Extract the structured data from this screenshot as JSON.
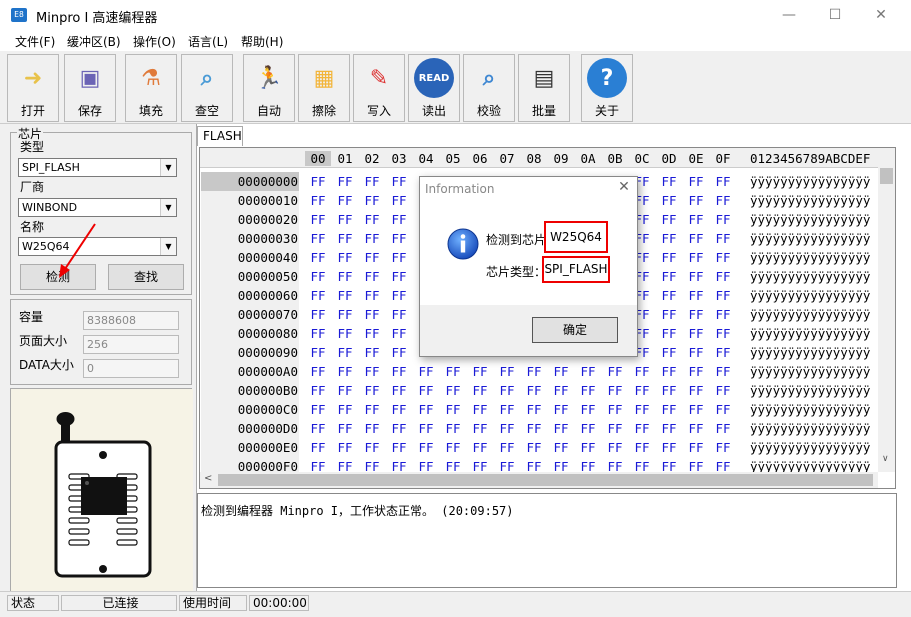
{
  "window": {
    "title": "Minpro I 高速编程器",
    "app_icon": "E8",
    "minimize": "—",
    "maximize": "☐",
    "close": "✕"
  },
  "menu": [
    "文件(F)",
    "缓冲区(B)",
    "操作(O)",
    "语言(L)",
    "帮助(H)"
  ],
  "toolbar": [
    {
      "label": "打开",
      "icon": "folder-open-icon",
      "glyph": "➜",
      "color": "#e8c24a"
    },
    {
      "label": "保存",
      "icon": "floppy-disk-icon",
      "glyph": "▣",
      "color": "#6b63b5"
    },
    {
      "label": "填充",
      "icon": "flask-icon",
      "glyph": "⚗",
      "color": "#e07a3a"
    },
    {
      "label": "查空",
      "icon": "magnifier-icon",
      "glyph": "⌕",
      "color": "#4a9bd6"
    },
    {
      "label": "自动",
      "icon": "running-man-icon",
      "glyph": "🏃",
      "color": "#f39a1c"
    },
    {
      "label": "擦除",
      "icon": "box-icon",
      "glyph": "▦",
      "color": "#f2b53a"
    },
    {
      "label": "写入",
      "icon": "pencil-paper-icon",
      "glyph": "✎",
      "color": "#d33"
    },
    {
      "label": "读出",
      "icon": "read-disc-icon",
      "glyph": "READ",
      "color": "#2a64b8"
    },
    {
      "label": "校验",
      "icon": "verify-magnifier-icon",
      "glyph": "⌕",
      "color": "#3e87d2"
    },
    {
      "label": "批量",
      "icon": "chip-icon",
      "glyph": "▤",
      "color": "#333"
    },
    {
      "label": "关于",
      "icon": "help-icon",
      "glyph": "?",
      "color": "#2a7fd4"
    }
  ],
  "chip_group": {
    "title": "芯片",
    "type_label": "类型",
    "type_value": "SPI_FLASH",
    "vendor_label": "厂商",
    "vendor_value": "WINBOND",
    "name_label": "名称",
    "name_value": "W25Q64",
    "detect_button": "检测",
    "search_button": "查找"
  },
  "info_fields": {
    "capacity_label": "容量",
    "capacity_value": "8388608",
    "page_size_label": "页面大小",
    "page_size_value": "256",
    "data_size_label": "DATA大小",
    "data_size_value": "0"
  },
  "buffer": {
    "tab": "FLASH",
    "columns": [
      "00",
      "01",
      "02",
      "03",
      "04",
      "05",
      "06",
      "07",
      "08",
      "09",
      "0A",
      "0B",
      "0C",
      "0D",
      "0E",
      "0F"
    ],
    "ascii_header": "0123456789ABCDEF",
    "rows": [
      {
        "addr": "00000000",
        "bytes": "FF",
        "ascii": "ÿÿÿÿÿÿÿÿÿÿÿÿÿÿÿÿ"
      },
      {
        "addr": "00000010",
        "bytes": "FF",
        "ascii": "ÿÿÿÿÿÿÿÿÿÿÿÿÿÿÿÿ"
      },
      {
        "addr": "00000020",
        "bytes": "FF",
        "ascii": "ÿÿÿÿÿÿÿÿÿÿÿÿÿÿÿÿ"
      },
      {
        "addr": "00000030",
        "bytes": "FF",
        "ascii": "ÿÿÿÿÿÿÿÿÿÿÿÿÿÿÿÿ"
      },
      {
        "addr": "00000040",
        "bytes": "FF",
        "ascii": "ÿÿÿÿÿÿÿÿÿÿÿÿÿÿÿÿ"
      },
      {
        "addr": "00000050",
        "bytes": "FF",
        "ascii": "ÿÿÿÿÿÿÿÿÿÿÿÿÿÿÿÿ"
      },
      {
        "addr": "00000060",
        "bytes": "FF",
        "ascii": "ÿÿÿÿÿÿÿÿÿÿÿÿÿÿÿÿ"
      },
      {
        "addr": "00000070",
        "bytes": "FF",
        "ascii": "ÿÿÿÿÿÿÿÿÿÿÿÿÿÿÿÿ"
      },
      {
        "addr": "00000080",
        "bytes": "FF",
        "ascii": "ÿÿÿÿÿÿÿÿÿÿÿÿÿÿÿÿ"
      },
      {
        "addr": "00000090",
        "bytes": "FF",
        "ascii": "ÿÿÿÿÿÿÿÿÿÿÿÿÿÿÿÿ"
      },
      {
        "addr": "000000A0",
        "bytes": "FF",
        "ascii": "ÿÿÿÿÿÿÿÿÿÿÿÿÿÿÿÿ"
      },
      {
        "addr": "000000B0",
        "bytes": "FF",
        "ascii": "ÿÿÿÿÿÿÿÿÿÿÿÿÿÿÿÿ"
      },
      {
        "addr": "000000C0",
        "bytes": "FF",
        "ascii": "ÿÿÿÿÿÿÿÿÿÿÿÿÿÿÿÿ"
      },
      {
        "addr": "000000D0",
        "bytes": "FF",
        "ascii": "ÿÿÿÿÿÿÿÿÿÿÿÿÿÿÿÿ"
      },
      {
        "addr": "000000E0",
        "bytes": "FF",
        "ascii": "ÿÿÿÿÿÿÿÿÿÿÿÿÿÿÿÿ"
      },
      {
        "addr": "000000F0",
        "bytes": "FF",
        "ascii": "ÿÿÿÿÿÿÿÿÿÿÿÿÿÿÿÿ"
      }
    ]
  },
  "log": {
    "message": "检测到编程器 Minpro I，工作状态正常。 (20:09:57)"
  },
  "status": {
    "state_label": "状态",
    "state_value": "已连接",
    "time_label": "使用时间",
    "time_value": "00:00:00"
  },
  "dialog": {
    "title": "Information",
    "close": "✕",
    "icon": "info-icon",
    "chip_label": "检测到芯片",
    "chip_value": "W25Q64",
    "type_label": "芯片类型：",
    "type_value": "SPI_FLASH",
    "ok_button": "确定"
  },
  "colors": {
    "hex_bytes": "#1a1ad6",
    "highlight_box": "#e00000",
    "annotation_arrow": "#e00000"
  }
}
